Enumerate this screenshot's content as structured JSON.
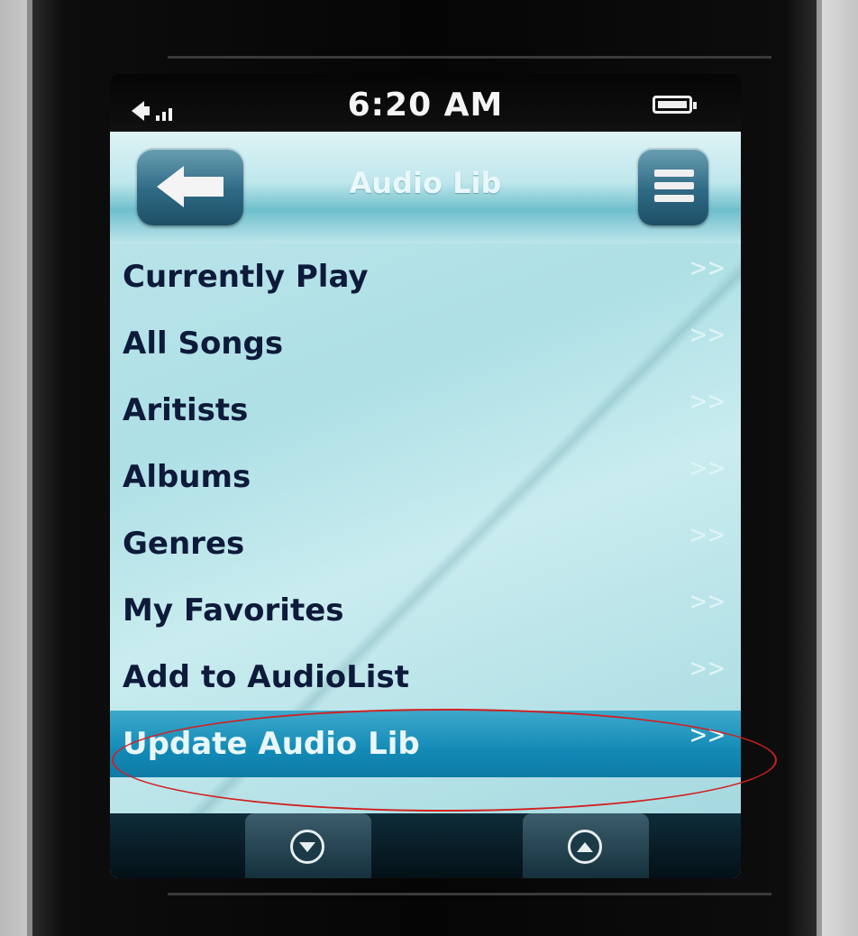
{
  "status": {
    "time": "6:20 AM"
  },
  "header": {
    "title": "Audio Lib"
  },
  "menu": {
    "items": [
      {
        "label": "Currently Play",
        "arrow": ">>"
      },
      {
        "label": "All Songs",
        "arrow": ">>"
      },
      {
        "label": "Aritists",
        "arrow": ">>"
      },
      {
        "label": "Albums",
        "arrow": ">>"
      },
      {
        "label": "Genres",
        "arrow": ">>"
      },
      {
        "label": "My Favorites",
        "arrow": ">>"
      },
      {
        "label": "Add to AudioList",
        "arrow": ">>"
      },
      {
        "label": "Update Audio Lib",
        "arrow": ">>"
      }
    ],
    "selected": "Update Audio Lib"
  },
  "icons": {
    "volume": "speaker-icon",
    "signal": "signal-bars-icon",
    "battery": "battery-icon",
    "back": "back-arrow-icon",
    "menu": "list-menu-icon",
    "scroll_down": "chevron-down-icon",
    "scroll_up": "chevron-up-icon"
  },
  "colors": {
    "background": "#bde5ea",
    "selected_row": "#128ab6",
    "item_text": "#0d1a3a",
    "annotation": "#d12020"
  }
}
